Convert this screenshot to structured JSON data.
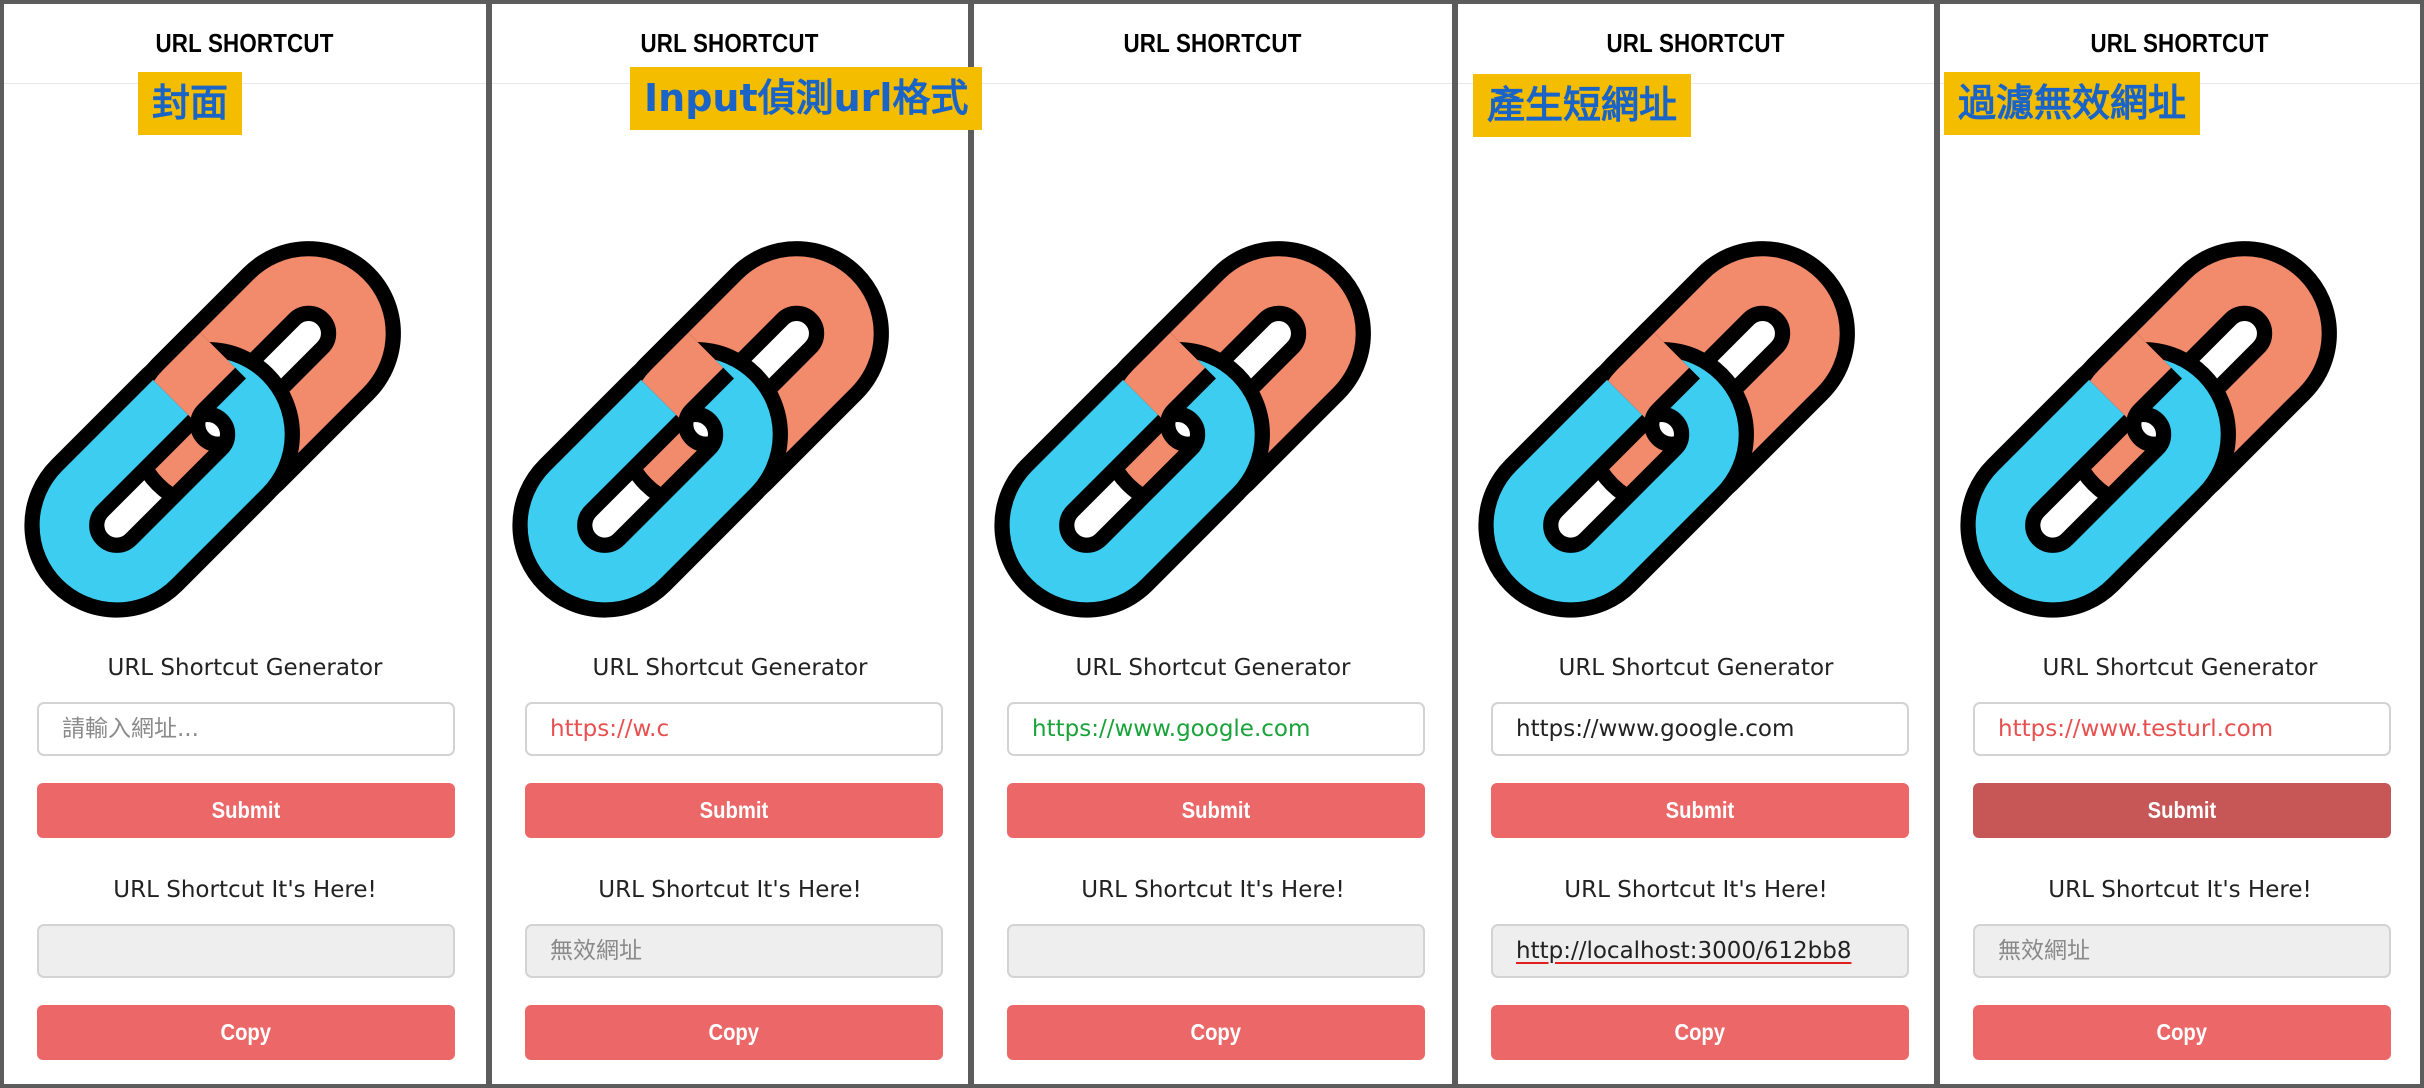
{
  "colors": {
    "submit_button": "#ec6767",
    "submit_button_pressed": "#c75757",
    "invalid_text": "#e85050",
    "valid_text": "#1aa33a",
    "normal_text": "#222222",
    "placeholder_text": "#8a8a8a",
    "tag_background": "#f5bd00",
    "tag_text": "#1a64c8",
    "chain_link_blue": "#3ccdf1",
    "chain_link_orange": "#f28a6c"
  },
  "panels": [
    {
      "tag": "封面",
      "header_title": "URL SHORTCUT",
      "logo_icon": "chain-link-icon",
      "generator_title": "URL Shortcut Generator",
      "input_value": "",
      "input_placeholder": "請輸入網址...",
      "input_state": "empty",
      "submit_label": "Submit",
      "submit_pressed": false,
      "result_title": "URL Shortcut It's Here!",
      "result_value": "",
      "result_placeholder": "",
      "copy_label": "Copy"
    },
    {
      "tag": "Input偵測url格式",
      "header_title": "URL SHORTCUT",
      "logo_icon": "chain-link-icon",
      "generator_title": "URL Shortcut Generator",
      "input_value": "https://w.c",
      "input_placeholder": "",
      "input_state": "invalid",
      "submit_label": "Submit",
      "submit_pressed": false,
      "result_title": "URL Shortcut It's Here!",
      "result_value": "",
      "result_placeholder": "無效網址",
      "copy_label": "Copy"
    },
    {
      "tag": "",
      "header_title": "URL SHORTCUT",
      "logo_icon": "chain-link-icon",
      "generator_title": "URL Shortcut Generator",
      "input_value": "https://www.google.com",
      "input_placeholder": "",
      "input_state": "valid",
      "submit_label": "Submit",
      "submit_pressed": false,
      "result_title": "URL Shortcut It's Here!",
      "result_value": "",
      "result_placeholder": "",
      "copy_label": "Copy"
    },
    {
      "tag": "產生短網址",
      "header_title": "URL SHORTCUT",
      "logo_icon": "chain-link-icon",
      "generator_title": "URL Shortcut Generator",
      "input_value": "https://www.google.com",
      "input_placeholder": "",
      "input_state": "normal",
      "submit_label": "Submit",
      "submit_pressed": false,
      "result_title": "URL Shortcut It's Here!",
      "result_value": "http://localhost:3000/612bb8",
      "result_placeholder": "",
      "copy_label": "Copy"
    },
    {
      "tag": "過濾無效網址",
      "header_title": "URL SHORTCUT",
      "logo_icon": "chain-link-icon",
      "generator_title": "URL Shortcut Generator",
      "input_value": "https://www.testurl.com",
      "input_placeholder": "",
      "input_state": "invalid",
      "submit_label": "Submit",
      "submit_pressed": true,
      "result_title": "URL Shortcut It's Here!",
      "result_value": "",
      "result_placeholder": "無效網址",
      "copy_label": "Copy"
    }
  ]
}
